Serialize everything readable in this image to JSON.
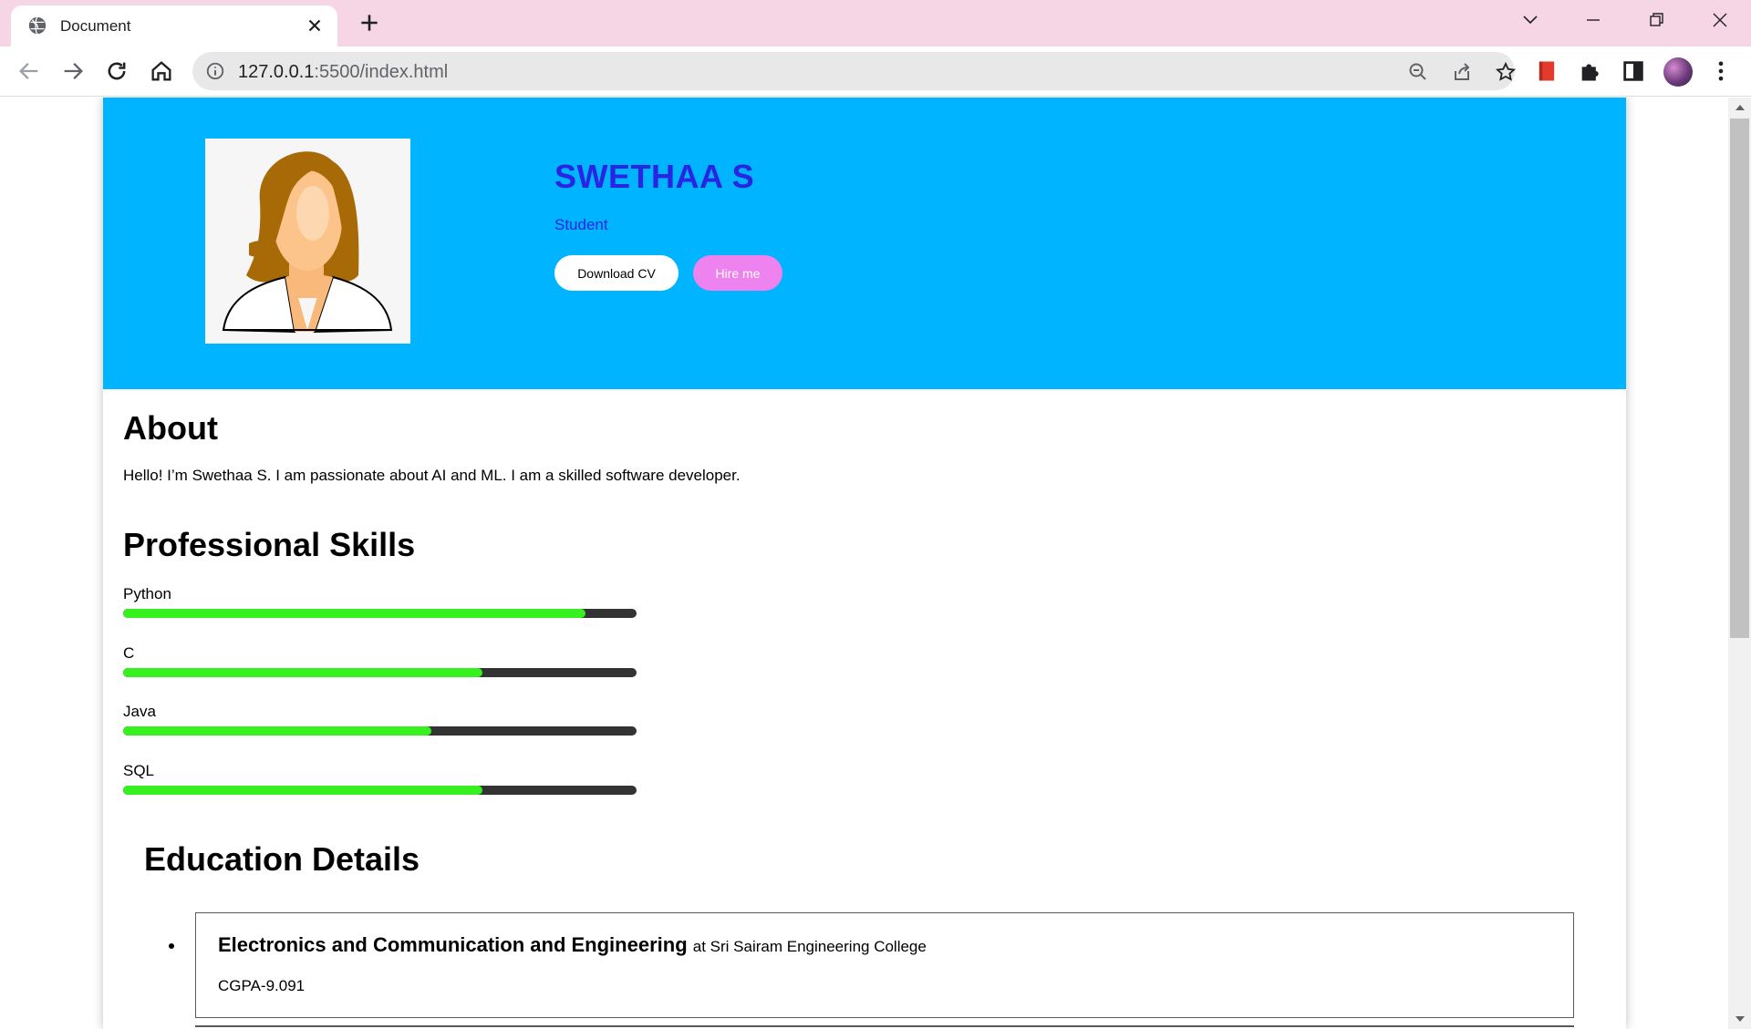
{
  "browser": {
    "tab_title": "Document",
    "url_host": "127.0.0.1",
    "url_rest": ":5500/index.html"
  },
  "profile": {
    "name": "SWETHAA S",
    "role": "Student",
    "download_label": "Download CV",
    "hire_label": "Hire me"
  },
  "about": {
    "heading": "About",
    "text": "Hello! I’m Swethaa S. I am passionate about AI and ML. I am a skilled software developer."
  },
  "skills": {
    "heading": "Professional Skills",
    "items": [
      {
        "name": "Python",
        "level": 0.9
      },
      {
        "name": "C",
        "level": 0.7
      },
      {
        "name": "Java",
        "level": 0.6
      },
      {
        "name": "SQL",
        "level": 0.7
      }
    ]
  },
  "education": {
    "heading": "Education Details",
    "items": [
      {
        "degree": "Electronics and Communication and Engineering",
        "college": "at Sri Sairam Engineering College",
        "cgpa": "CGPA-9.091"
      }
    ]
  },
  "colors": {
    "header_bg": "#00b4ff",
    "name_color": "#2a25e5",
    "hire_bg": "#ee82ee",
    "skill_fill": "#37f01f",
    "skill_track": "#333333",
    "tabbar_bg": "#f6d5e5"
  }
}
